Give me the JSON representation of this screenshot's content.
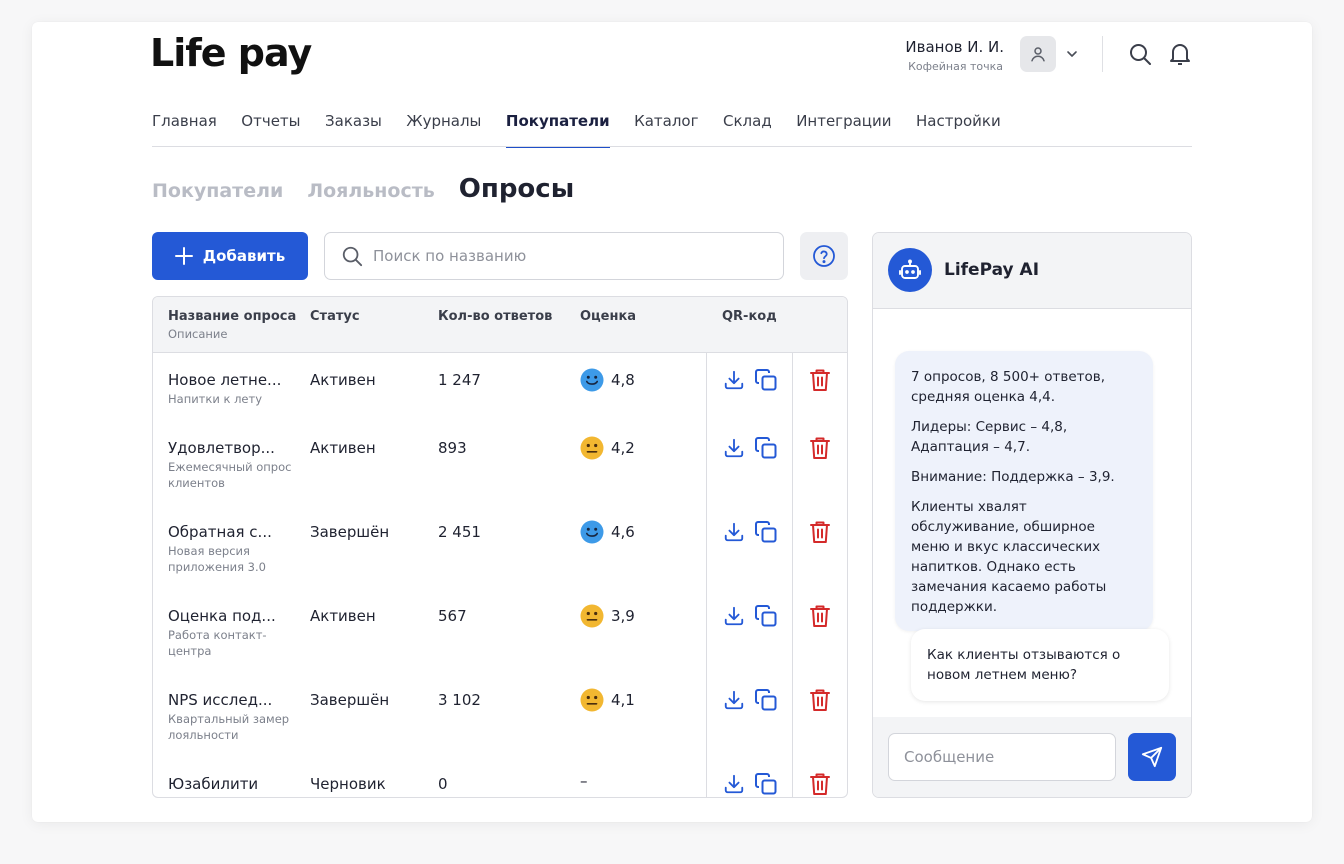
{
  "brand": {
    "logo_text": "Life pay"
  },
  "user": {
    "name": "Иванов И. И.",
    "org": "Кофейная точка"
  },
  "nav": {
    "items": [
      {
        "label": "Главная"
      },
      {
        "label": "Отчеты"
      },
      {
        "label": "Заказы"
      },
      {
        "label": "Журналы"
      },
      {
        "label": "Покупатели",
        "active": true
      },
      {
        "label": "Каталог"
      },
      {
        "label": "Склад"
      },
      {
        "label": "Интеграции"
      },
      {
        "label": "Настройки"
      }
    ]
  },
  "subtabs": {
    "items": [
      {
        "label": "Покупатели"
      },
      {
        "label": "Лояльность"
      },
      {
        "label": "Опросы",
        "active": true
      }
    ]
  },
  "toolbar": {
    "add_label": "Добавить",
    "search_placeholder": "Поиск по названию"
  },
  "table": {
    "columns": {
      "name": "Название опроса",
      "name_sub": "Описание",
      "status": "Статус",
      "answers": "Кол-во ответов",
      "score": "Оценка",
      "qr": "QR-код"
    },
    "rows": [
      {
        "name": "Новое летне...",
        "desc": "Напитки к лету",
        "status": "Активен",
        "answers": "1 247",
        "mood": "happy",
        "score": "4,8"
      },
      {
        "name": "Удовлетвор...",
        "desc": "Ежемесячный опрос клиентов",
        "status": "Активен",
        "answers": "893",
        "mood": "neutral",
        "score": "4,2"
      },
      {
        "name": "Обратная с...",
        "desc": "Новая версия приложения 3.0",
        "status": "Завершён",
        "answers": "2 451",
        "mood": "happy",
        "score": "4,6"
      },
      {
        "name": "Оценка под...",
        "desc": "Работа контакт-центра",
        "status": "Активен",
        "answers": "567",
        "mood": "neutral",
        "score": "3,9"
      },
      {
        "name": "NPS исслед...",
        "desc": "Квартальный замер лояльности",
        "status": "Завершён",
        "answers": "3 102",
        "mood": "neutral",
        "score": "4,1"
      },
      {
        "name": "Юзабилити",
        "desc": "",
        "status": "Черновик",
        "answers": "0",
        "mood": "none",
        "score": "–"
      }
    ]
  },
  "ai": {
    "title": "LifePay AI",
    "messages": {
      "assistant": [
        "7 опросов, 8 500+ ответов, средняя оценка 4,4.",
        "Лидеры: Сервис – 4,8, Адаптация – 4,7.",
        "Внимание: Поддержка – 3,9.",
        "Клиенты хвалят обслуживание, обширное меню и вкус классических напитков. Однако есть замечания касаемо работы поддержки."
      ],
      "user": "Как клиенты отзываются о новом летнем меню?"
    },
    "input_placeholder": "Сообщение"
  },
  "colors": {
    "accent": "#2459d6",
    "danger": "#d42a2a",
    "emoji_happy": "#3d9ae8",
    "emoji_neutral": "#f2b731"
  },
  "icons": {
    "user": "user-icon",
    "chevron": "chevron-down-icon",
    "search": "search-icon",
    "bell": "bell-icon",
    "plus": "plus-icon",
    "help": "help-icon",
    "download": "download-icon",
    "copy": "copy-icon",
    "trash": "trash-icon",
    "bot": "bot-icon",
    "send": "send-icon"
  }
}
